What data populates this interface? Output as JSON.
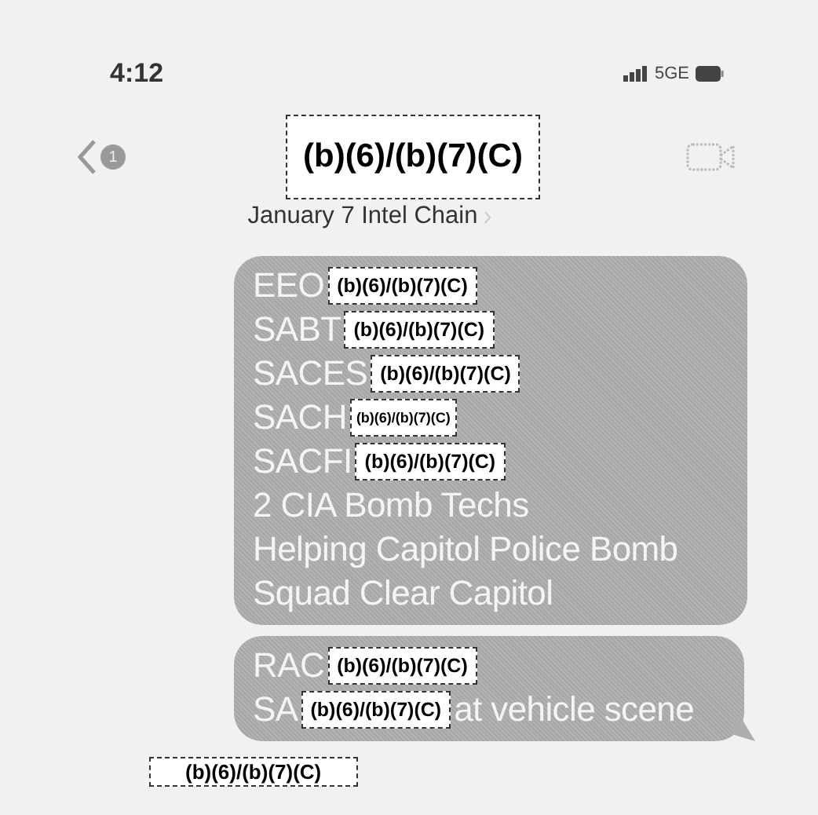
{
  "status_bar": {
    "time": "4:12",
    "network": "5GE"
  },
  "header": {
    "badge": "1",
    "title": "(b)(6)/(b)(7)(C)",
    "subtitle": "January 7 Intel Chain"
  },
  "messages": [
    {
      "lines": [
        [
          {
            "kind": "text",
            "text": "EEO"
          },
          {
            "kind": "redaction",
            "text": "(b)(6)/(b)(7)(C)"
          }
        ],
        [
          {
            "kind": "text",
            "text": "SABT"
          },
          {
            "kind": "redaction",
            "text": "(b)(6)/(b)(7)(C)"
          }
        ],
        [
          {
            "kind": "text",
            "text": "SACES"
          },
          {
            "kind": "redaction",
            "text": "(b)(6)/(b)(7)(C)"
          }
        ],
        [
          {
            "kind": "text",
            "text": "SACH"
          },
          {
            "kind": "small_redaction",
            "text": "(b)(6)/(b)(7)(C)"
          }
        ],
        [
          {
            "kind": "text",
            "text": "SACFI"
          },
          {
            "kind": "redaction",
            "text": "(b)(6)/(b)(7)(C)"
          }
        ],
        [
          {
            "kind": "text",
            "text": "2 CIA Bomb Techs"
          }
        ],
        [
          {
            "kind": "text",
            "text": "Helping Capitol Police Bomb"
          }
        ],
        [
          {
            "kind": "text",
            "text": "Squad Clear Capitol"
          }
        ]
      ],
      "tail": false
    },
    {
      "lines": [
        [
          {
            "kind": "text",
            "text": "RAC"
          },
          {
            "kind": "redaction",
            "text": "(b)(6)/(b)(7)(C)"
          }
        ],
        [
          {
            "kind": "text",
            "text": "SA"
          },
          {
            "kind": "redaction",
            "text": "(b)(6)/(b)(7)(C)"
          },
          {
            "kind": "text",
            "text": "at vehicle scene"
          }
        ]
      ],
      "tail": true
    }
  ],
  "sender": {
    "text": "(b)(6)/(b)(7)(C)"
  }
}
